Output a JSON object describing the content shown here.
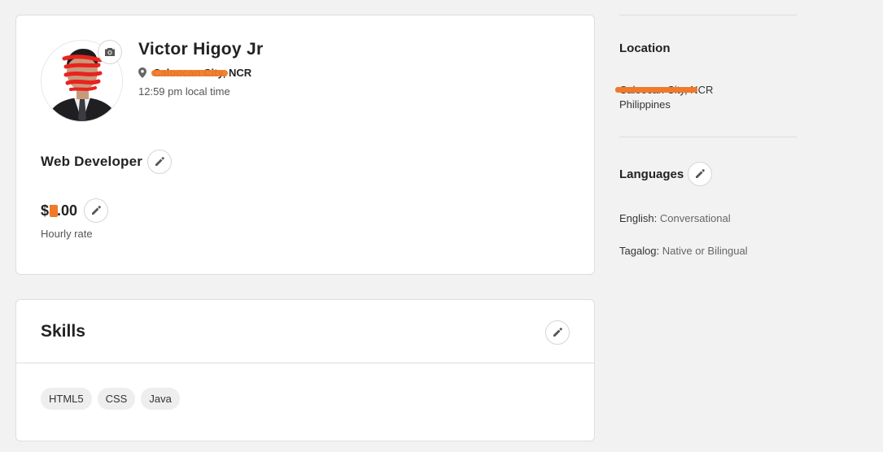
{
  "profile": {
    "name": "Victor Higoy Jr",
    "location": "Caloocan City, NCR",
    "local_time": "12:59 pm local time",
    "title": "Web Developer",
    "rate": "$5.00",
    "rate_label": "Hourly rate"
  },
  "skills": {
    "heading": "Skills",
    "items": [
      "HTML5",
      "CSS",
      "Java"
    ]
  },
  "sidebar": {
    "location_heading": "Location",
    "location_city": "Caloocan City, NCR",
    "location_country": "Philippines",
    "languages_heading": "Languages",
    "languages": [
      {
        "name": "English:",
        "level": "Conversational"
      },
      {
        "name": "Tagalog:",
        "level": "Native or Bilingual"
      }
    ]
  },
  "icons": {
    "camera": "camera-icon",
    "pin": "map-pin-icon",
    "edit": "pencil-icon"
  },
  "colors": {
    "redaction": "#f07a2a",
    "background": "#f2f2f3"
  }
}
